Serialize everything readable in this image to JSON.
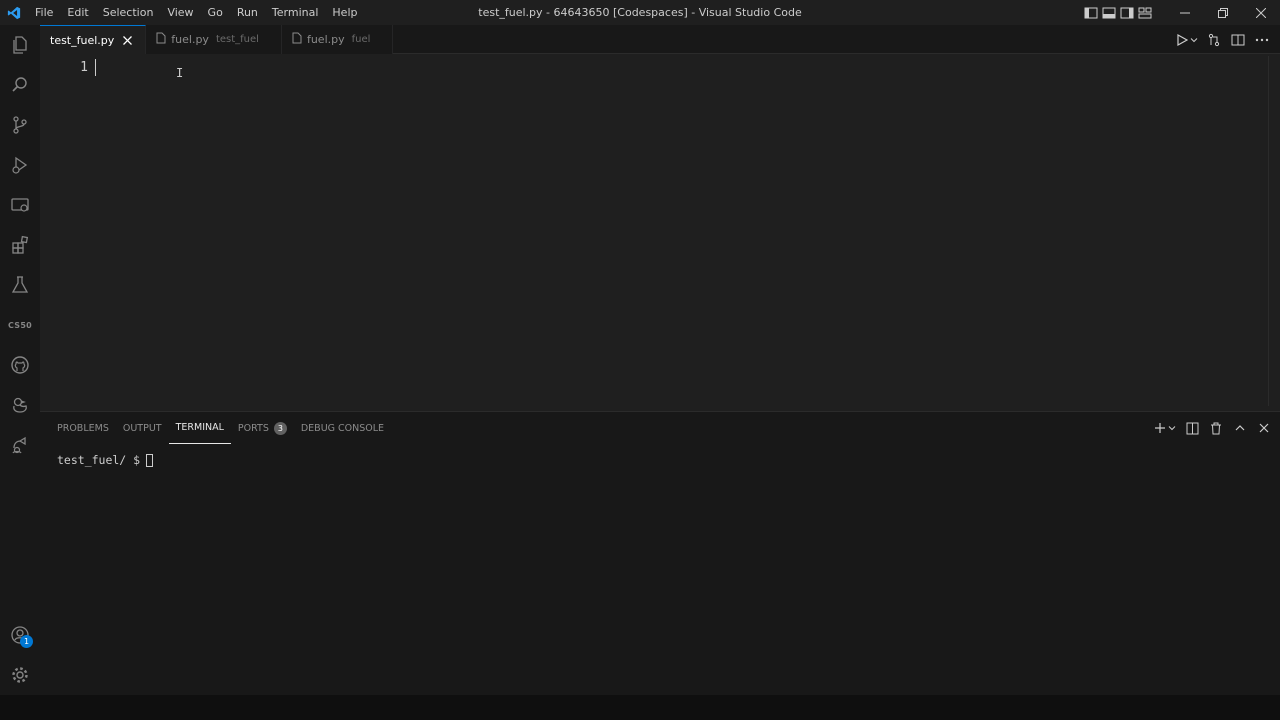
{
  "window": {
    "title": "test_fuel.py - 64643650 [Codespaces] - Visual Studio Code"
  },
  "menu": [
    "File",
    "Edit",
    "Selection",
    "View",
    "Go",
    "Run",
    "Terminal",
    "Help"
  ],
  "activity_bar": {
    "items": [
      "explorer-icon",
      "search-icon",
      "source-control-icon",
      "run-debug-icon",
      "remote-explorer-icon",
      "extensions-icon",
      "testing-icon",
      "cs50-icon",
      "github-icon",
      "ducky-icon",
      "live-share-icon"
    ],
    "cs50_label": "CS50",
    "bottom": [
      "accounts-icon",
      "manage-gear-icon"
    ],
    "accounts_badge": "1"
  },
  "tabs": [
    {
      "name": "test_fuel.py",
      "description": "",
      "active": true
    },
    {
      "name": "fuel.py",
      "description": "test_fuel",
      "active": false
    },
    {
      "name": "fuel.py",
      "description": "fuel",
      "active": false
    }
  ],
  "editor": {
    "line_numbers": [
      "1"
    ],
    "content": ""
  },
  "panel": {
    "tabs": [
      {
        "label": "PROBLEMS",
        "active": false
      },
      {
        "label": "OUTPUT",
        "active": false
      },
      {
        "label": "TERMINAL",
        "active": true
      },
      {
        "label": "PORTS",
        "active": false,
        "badge": "3"
      },
      {
        "label": "DEBUG CONSOLE",
        "active": false
      }
    ],
    "terminal_prompt": "test_fuel/ $"
  },
  "colors": {
    "accent": "#0078d4",
    "background": "#1f1f1f",
    "sidebar": "#181818"
  }
}
